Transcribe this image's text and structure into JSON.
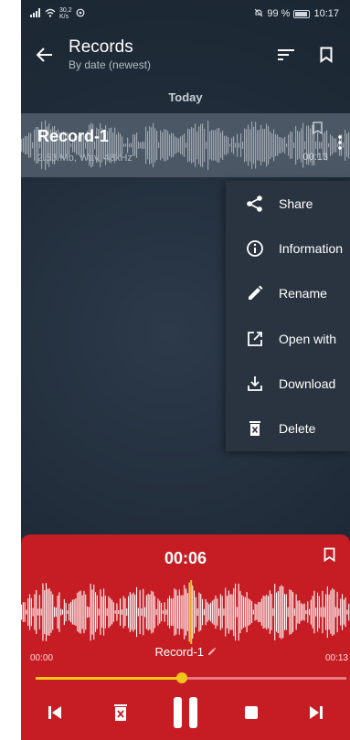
{
  "status_bar": {
    "net_speed_value": "30,2",
    "net_speed_unit": "K/s",
    "battery": "99 %",
    "time": "10:17"
  },
  "app_bar": {
    "title": "Records",
    "subtitle": "By date (newest)",
    "icons": [
      "back-arrow-icon",
      "sort-icon",
      "bookmark-icon"
    ]
  },
  "list": {
    "section_header": "Today",
    "records": [
      {
        "name": "Record-1",
        "meta": "2.53 Mb, Wav, 48kHz",
        "duration": "00:13"
      }
    ]
  },
  "context_menu": {
    "items": [
      {
        "label": "Share",
        "icon": "share-icon"
      },
      {
        "label": "Information",
        "icon": "info-icon"
      },
      {
        "label": "Rename",
        "icon": "pencil-icon"
      },
      {
        "label": "Open with",
        "icon": "open-external-icon"
      },
      {
        "label": "Download",
        "icon": "download-icon"
      },
      {
        "label": "Delete",
        "icon": "trash-icon"
      }
    ]
  },
  "player": {
    "current_time": "00:06",
    "start_time": "00:00",
    "end_time": "00:13",
    "record_name": "Record-1",
    "progress_fraction": 0.47,
    "state": "playing",
    "controls": [
      "skip-previous-icon",
      "delete-icon",
      "pause-icon",
      "stop-icon",
      "skip-next-icon"
    ]
  },
  "colors": {
    "background": "#1f2b38",
    "selected_row": "#4b5765",
    "menu_background": "#2a3440",
    "player_background": "#c61d24",
    "accent_yellow": "#f5c518"
  }
}
